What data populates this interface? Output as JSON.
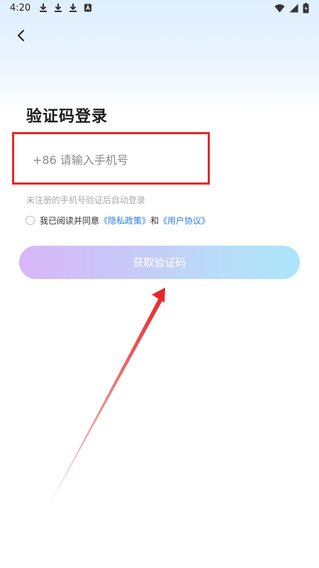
{
  "status_bar": {
    "time": "4:20",
    "left_icons": [
      "download-icon",
      "download-icon",
      "download-icon",
      "a-box-icon"
    ],
    "right_icons": [
      "wifi-icon",
      "signal-icon",
      "battery-icon"
    ]
  },
  "header": {
    "back_icon": "chevron-left-icon"
  },
  "page": {
    "title": "验证码登录"
  },
  "phone_input": {
    "placeholder": "+86 请输入手机号",
    "value": ""
  },
  "hint": "未注册的手机号验证后自动登录",
  "agreement": {
    "prefix": "我已阅读并同意",
    "privacy_link": "《隐私政策》",
    "joiner": "和",
    "user_link": "《用户协议》",
    "checked": false
  },
  "primary_button": {
    "label": "获取验证码"
  },
  "colors": {
    "highlight_border": "#e8262a",
    "link": "#2a7de1",
    "annotation_arrow": "#e8262a"
  }
}
